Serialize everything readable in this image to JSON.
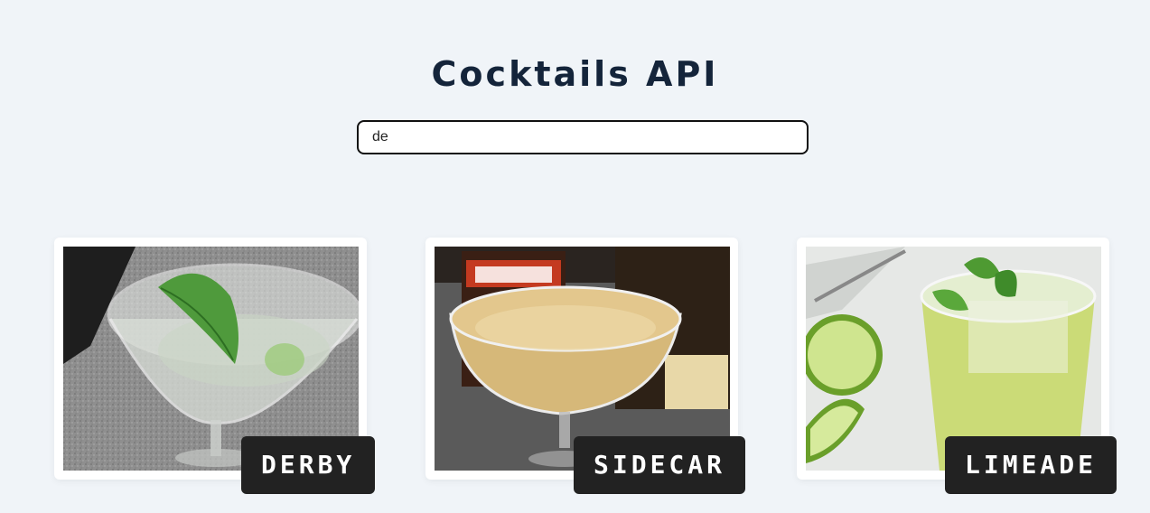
{
  "header": {
    "title": "Cocktails API"
  },
  "search": {
    "value": "de",
    "placeholder": ""
  },
  "cards": [
    {
      "name": "DERBY",
      "image": "derby-cocktail-photo"
    },
    {
      "name": "SIDECAR",
      "image": "sidecar-cocktail-photo"
    },
    {
      "name": "LIMEADE",
      "image": "limeade-cocktail-photo"
    }
  ],
  "colors": {
    "background": "#f0f4f8",
    "title": "#14243a",
    "label_bg": "#222222",
    "label_text": "#ffffff",
    "card_bg": "#ffffff"
  }
}
